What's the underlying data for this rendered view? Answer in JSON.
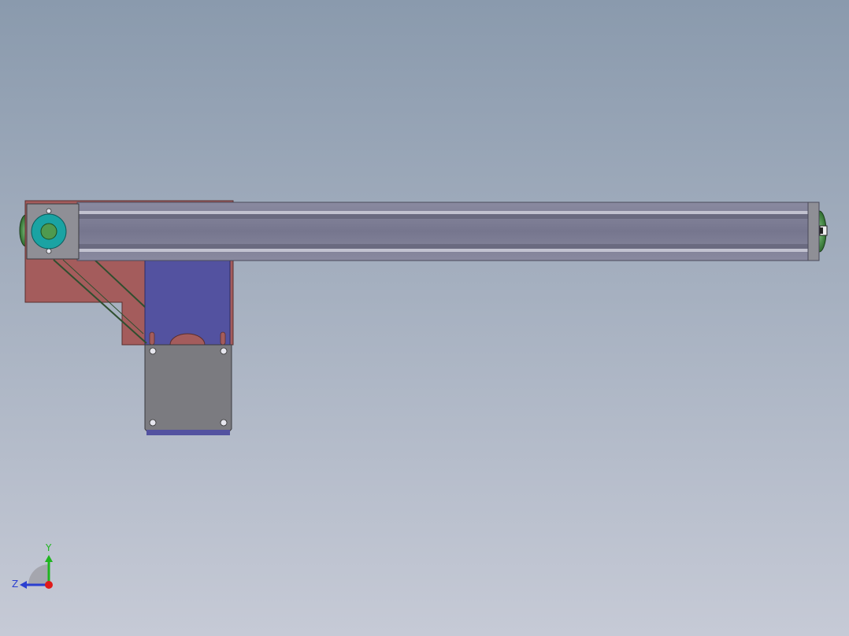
{
  "viewport": {
    "background_top": "#8a9aad",
    "background_bottom": "#c6cad6"
  },
  "colors": {
    "rail_body": "#7e7e95",
    "rail_highlight": "#c2c2d0",
    "rail_edge": "#4a4a5a",
    "end_plate": "#8f8f96",
    "bracket": "#a45c5c",
    "bracket_edge": "#5a2e2e",
    "motor_mount": "#5352a0",
    "motor_face": "#7b7b80",
    "bearing_outer": "#1aa3a3",
    "bearing_inner": "#4f9a4f",
    "pulley": "#3f8a3f",
    "belt": "#2f4f2f",
    "screw": "#e6e6ee"
  },
  "triad": {
    "y_label": "Y",
    "z_label": "Z",
    "y_color": "#1fb51f",
    "z_color": "#2b3fd0",
    "origin_color": "#e01a1a"
  }
}
